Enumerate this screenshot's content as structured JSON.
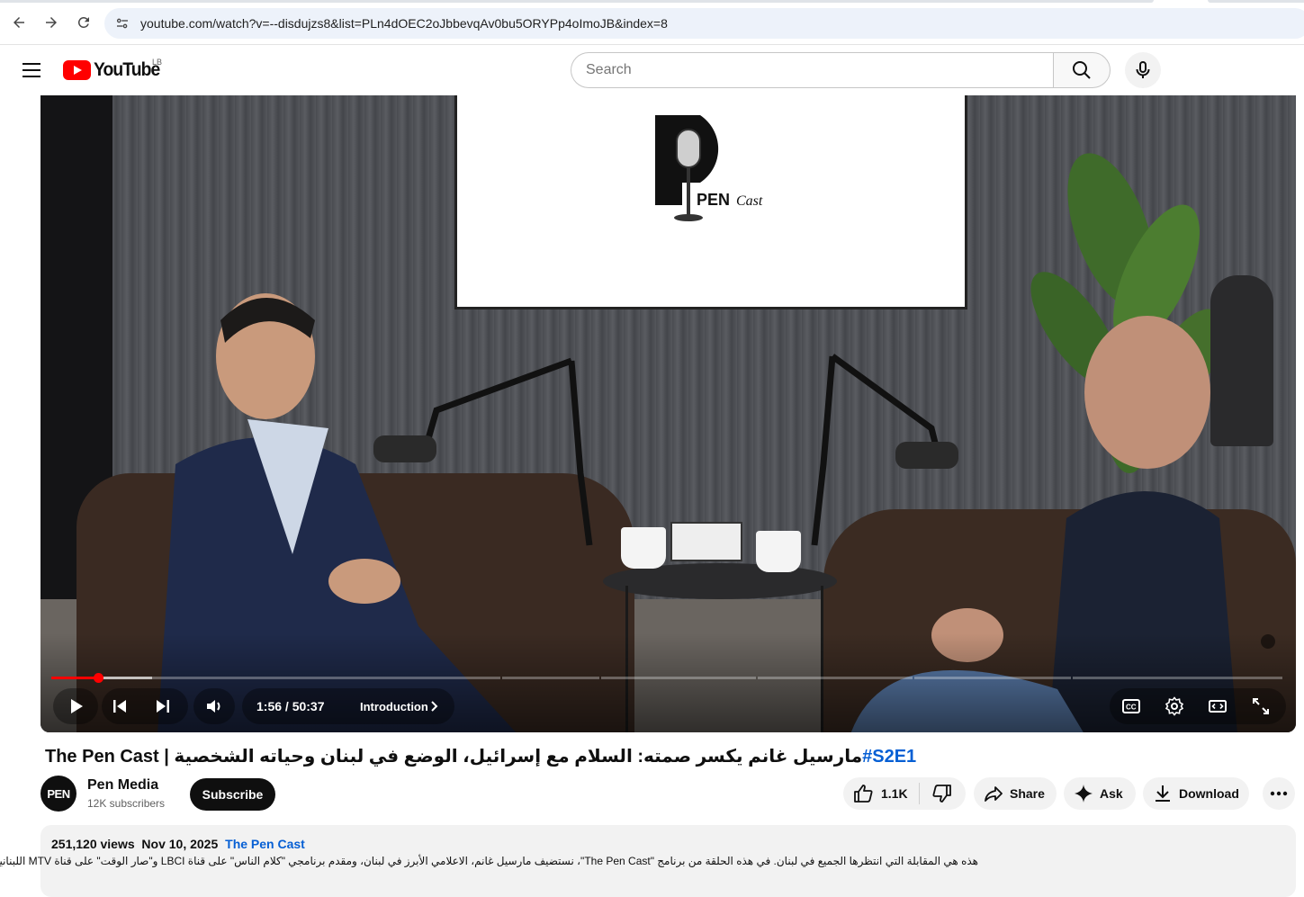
{
  "browser": {
    "url": "youtube.com/watch?v=--disdujzs8&list=PLn4dOEC2oJbbevqAv0bu5ORYPp4oImoJB&index=8"
  },
  "masthead": {
    "logo_text": "YouTube",
    "country_code": "LB",
    "search_placeholder": "Search"
  },
  "player": {
    "current_time": "1:56",
    "duration": "50:37",
    "time_display": "1:56 / 50:37",
    "chapter": "Introduction",
    "progress_fraction": 0.038,
    "screen_logo_text": "PEN",
    "screen_logo_script": "Cast"
  },
  "video": {
    "title_prefix": "The Pen Cast | ",
    "title_arabic": "مارسيل غانم يكسر صمته: السلام مع إسرائيل، الوضع في لبنان وحياته الشخصية",
    "title_hashtag": "#S2E1"
  },
  "channel": {
    "avatar_text": "PEN",
    "name": "Pen Media",
    "subscribers": "12K subscribers",
    "subscribe_label": "Subscribe"
  },
  "actions": {
    "like_count": "1.1K",
    "share_label": "Share",
    "ask_label": "Ask",
    "download_label": "Download"
  },
  "description": {
    "views": "251,120 views",
    "date": "Nov 10, 2025",
    "playlist_link": "The Pen Cast",
    "text": "هذه هي المقابلة التي انتظرها الجميع في لبنان. في هذه الحلقة من برنامج \"The Pen Cast\"، نستضيف مارسيل غانم، الاعلامي الأبرز في لبنان، ومقدم برنامجي \"كلام الناس\" على قناة LBCI و\"صار الوقت\" على قناة MTV اللبنانية."
  }
}
